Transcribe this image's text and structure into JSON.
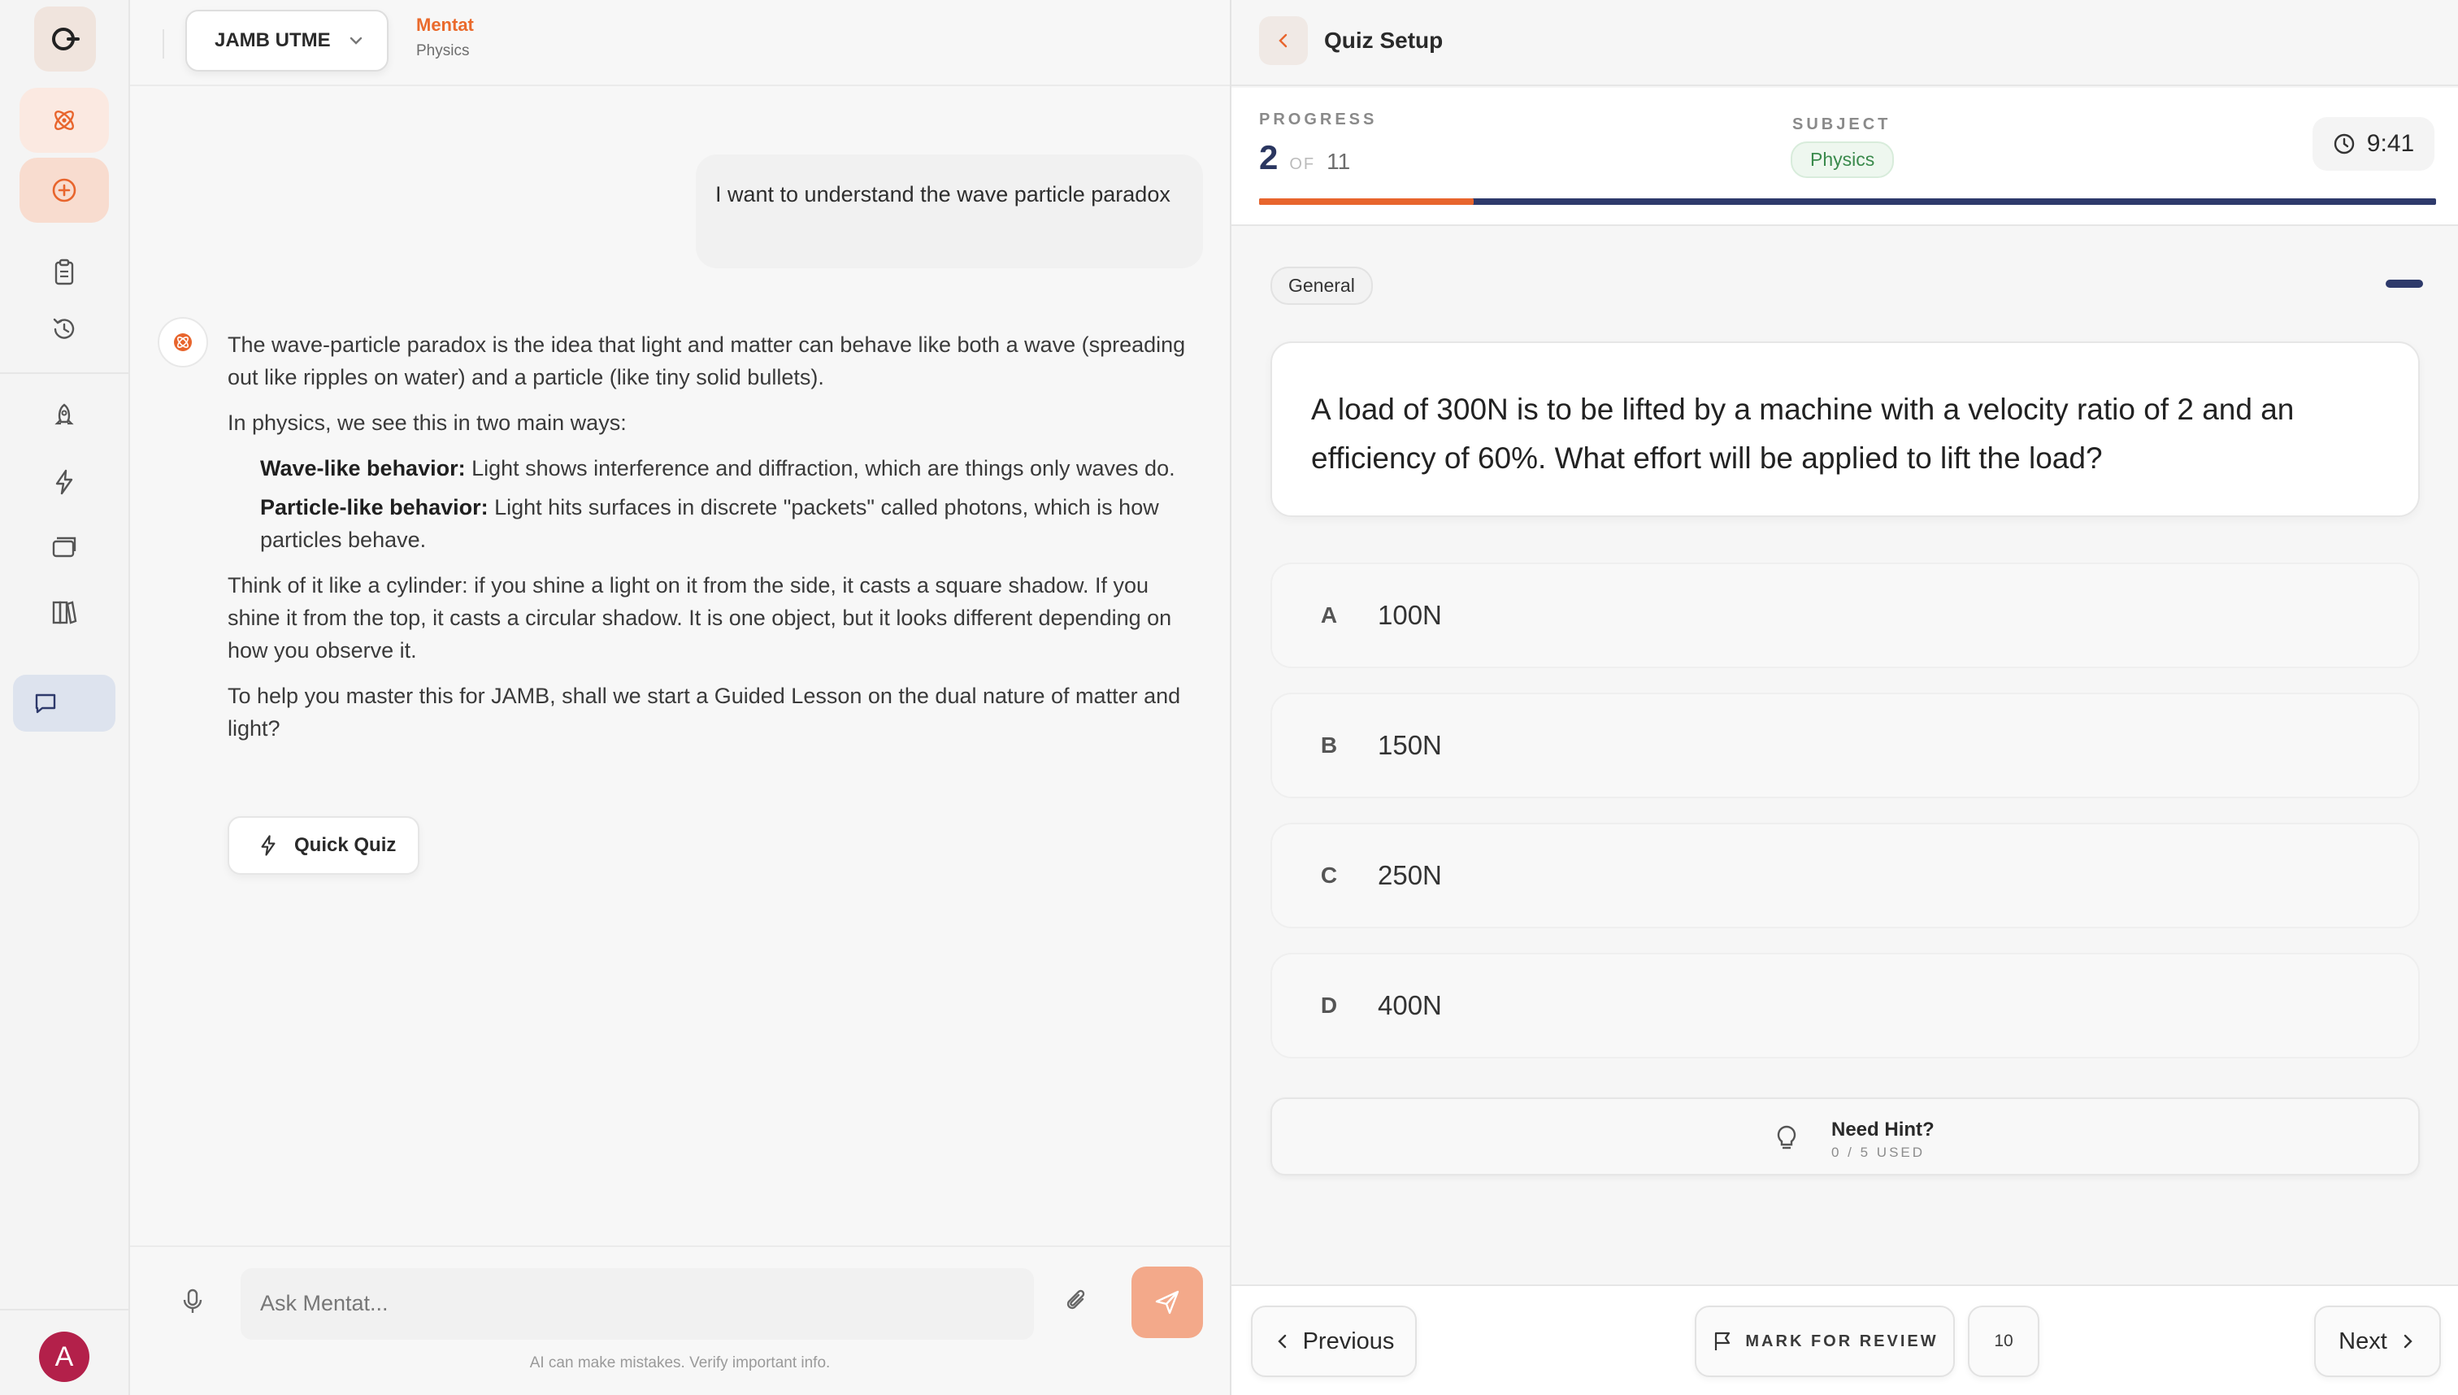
{
  "sidebar": {
    "avatar_initial": "A"
  },
  "chat": {
    "exam_selector": "JAMB UTME",
    "brand": "Mentat",
    "subject_subtitle": "Physics",
    "user_message": "I want to understand the wave particle paradox",
    "bot_message": {
      "p1": "The wave-particle paradox is the idea that light and matter can behave like both a wave (spreading out like ripples on water) and a particle (like tiny solid bullets).",
      "p2": "In physics, we see this in two main ways:",
      "bullet1_label": "Wave-like behavior:",
      "bullet1_text": " Light shows interference and diffraction, which are things only waves do.",
      "bullet2_label": "Particle-like behavior:",
      "bullet2_text": " Light hits surfaces in discrete \"packets\" called photons, which is how particles behave.",
      "p3": "Think of it like a cylinder: if you shine a light on it from the side, it casts a square shadow. If you shine it from the top, it casts a circular shadow. It is one object, but it looks different depending on how you observe it.",
      "p4": "To help you master this for JAMB, shall we start a Guided Lesson on the dual nature of matter and light?"
    },
    "quick_quiz_label": "Quick Quiz",
    "composer_placeholder": "Ask Mentat...",
    "disclaimer": "AI can make mistakes. Verify important info."
  },
  "quiz": {
    "title": "Quiz Setup",
    "progress_label": "PROGRESS",
    "progress_current": "2",
    "progress_of": "OF",
    "progress_total": "11",
    "progress_fraction": 0.182,
    "subject_label": "SUBJECT",
    "subject": "Physics",
    "timer": "9:41",
    "topic": "General",
    "question": "A load of 300N is to be lifted by a machine with a velocity ratio of 2 and an efficiency of 60%. What effort will be applied to lift the load?",
    "options": [
      {
        "letter": "A",
        "text": "100N"
      },
      {
        "letter": "B",
        "text": "150N"
      },
      {
        "letter": "C",
        "text": "250N"
      },
      {
        "letter": "D",
        "text": "400N"
      }
    ],
    "hint_title": "Need Hint?",
    "hint_usage": "0 / 5 USED",
    "previous_label": "Previous",
    "mark_review_label": "MARK FOR REVIEW",
    "question_number_badge": "10",
    "next_label": "Next"
  },
  "colors": {
    "accent": "#e8652d",
    "navy": "#2e3a6b",
    "send_button": "#f3a98a"
  }
}
